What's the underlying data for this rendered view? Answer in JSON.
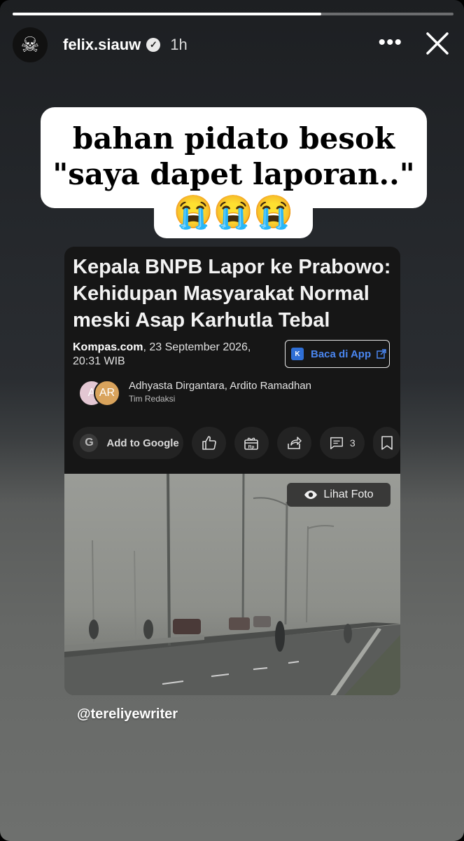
{
  "story": {
    "progress": 0.7,
    "username": "felix.siauw",
    "time": "1h",
    "more_label": "•••"
  },
  "caption": {
    "line1": "bahan pidato besok",
    "line2": "\"saya dapet laporan..\"",
    "emoji": "😭😭😭"
  },
  "article": {
    "headline": "Kepala BNPB Lapor ke Prabowo: Kehidupan Masyarakat Normal meski Asap Karhutla Tebal",
    "source_name": "Kompas.com",
    "source_date": ", 23 September 2026, 20:31 WIB",
    "app_button": "Baca di App",
    "author_initials_1": "A",
    "author_initials_2": "AR",
    "authors": "Adhyasta Dirgantara,  Ardito Ramadhan",
    "team": "Tim Redaksi",
    "add_google": "Add to Google",
    "comment_count": "3",
    "photo_button": "Lihat Foto"
  },
  "mention": "@tereliyewriter",
  "colors": {
    "app_link": "#4a86f0",
    "card_bg": "#161616"
  }
}
